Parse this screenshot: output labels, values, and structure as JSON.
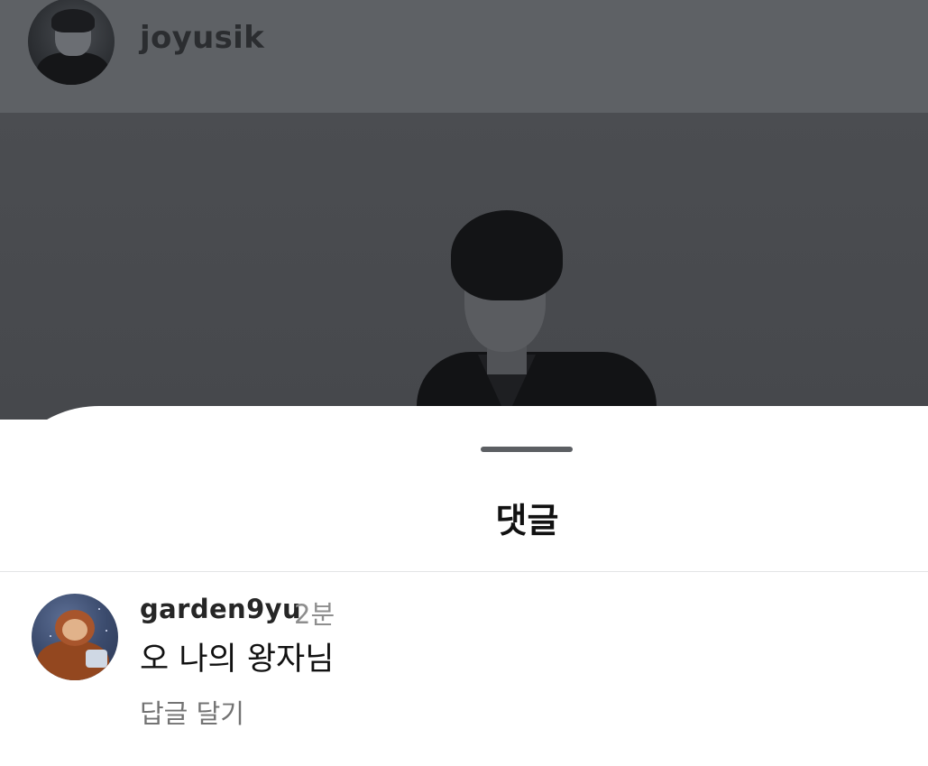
{
  "post": {
    "username": "joyusik",
    "avatar_icon": "profile-photo",
    "image_description_icon": "portrait-photo"
  },
  "sheet": {
    "title": "댓글"
  },
  "comments": [
    {
      "username": "garden9yu",
      "time": "2분",
      "text": "오 나의 왕자님",
      "reply_label": "답글 달기",
      "avatar_icon": "monkey-avatar"
    }
  ],
  "colors": {
    "dim_overlay": "#5e6165",
    "sheet_background": "#ffffff",
    "secondary_text": "#8e8e8e"
  }
}
